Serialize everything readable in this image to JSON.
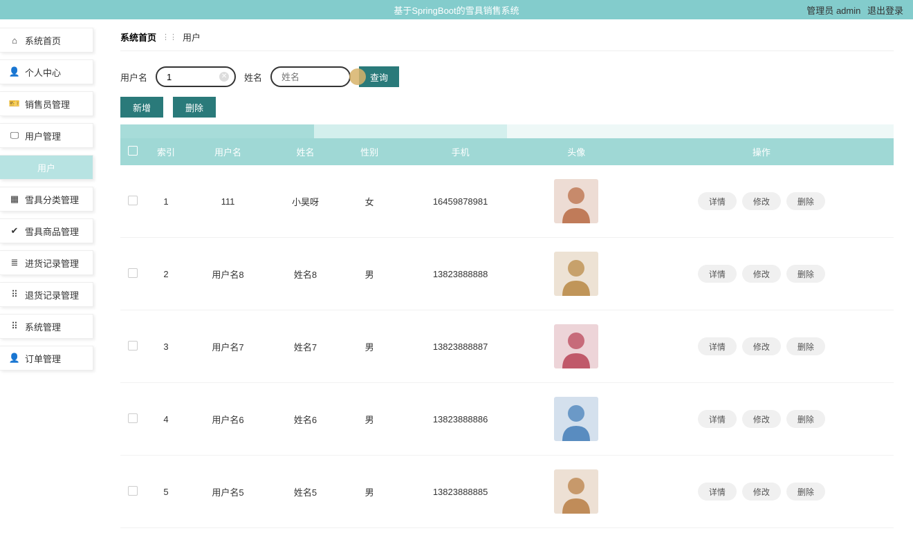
{
  "header": {
    "title": "基于SpringBoot的雪具销售系统",
    "role_label": "管理员",
    "username": "admin",
    "logout": "退出登录"
  },
  "sidebar": {
    "items": [
      {
        "icon": "home",
        "label": "系统首页"
      },
      {
        "icon": "person",
        "label": "个人中心"
      },
      {
        "icon": "ticket",
        "label": "销售员管理"
      },
      {
        "icon": "monitor",
        "label": "用户管理"
      },
      {
        "icon": "",
        "label": "用户",
        "active": true
      },
      {
        "icon": "box",
        "label": "雪具分类管理"
      },
      {
        "icon": "check",
        "label": "雪具商品管理"
      },
      {
        "icon": "list",
        "label": "进货记录管理"
      },
      {
        "icon": "grid",
        "label": "退货记录管理"
      },
      {
        "icon": "grid",
        "label": "系统管理"
      },
      {
        "icon": "person",
        "label": "订单管理"
      }
    ]
  },
  "breadcrumb": {
    "home": "系统首页",
    "current": "用户"
  },
  "filter": {
    "username_label": "用户名",
    "username_value": "1",
    "name_label": "姓名",
    "name_placeholder": "姓名",
    "query_label": "查询"
  },
  "action_buttons": {
    "add": "新增",
    "delete": "删除"
  },
  "table": {
    "headers": [
      "",
      "索引",
      "用户名",
      "姓名",
      "性别",
      "手机",
      "头像",
      "操作"
    ],
    "op_labels": {
      "detail": "详情",
      "edit": "修改",
      "delete": "删除"
    },
    "rows": [
      {
        "idx": "1",
        "username": "111",
        "name": "小昊呀",
        "gender": "女",
        "phone": "16459878981",
        "avatar_hue": 20
      },
      {
        "idx": "2",
        "username": "用户名8",
        "name": "姓名8",
        "gender": "男",
        "phone": "13823888888",
        "avatar_hue": 35
      },
      {
        "idx": "3",
        "username": "用户名7",
        "name": "姓名7",
        "gender": "男",
        "phone": "13823888887",
        "avatar_hue": 350
      },
      {
        "idx": "4",
        "username": "用户名6",
        "name": "姓名6",
        "gender": "男",
        "phone": "13823888886",
        "avatar_hue": 210
      },
      {
        "idx": "5",
        "username": "用户名5",
        "name": "姓名5",
        "gender": "男",
        "phone": "13823888885",
        "avatar_hue": 30
      }
    ]
  }
}
